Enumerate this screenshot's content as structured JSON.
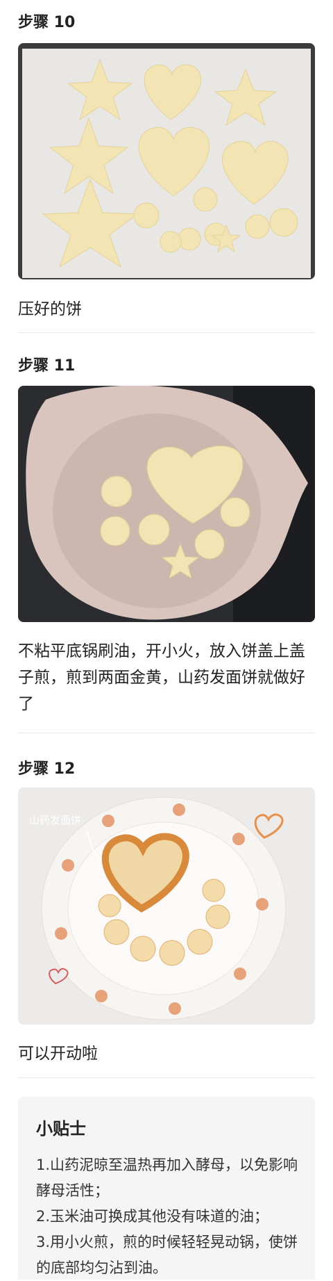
{
  "steps": [
    {
      "title": "步骤 10",
      "photo_icon": "baking-tray-photo",
      "description": "压好的饼"
    },
    {
      "title": "步骤 11",
      "photo_icon": "frying-pan-photo",
      "description": "不粘平底锅刷油，开小火，放入饼盖上盖子煎，煎到两面金黄，山药发面饼就做好了"
    },
    {
      "title": "步骤 12",
      "photo_icon": "plated-pancakes-photo",
      "photo_caption": "山药发面饼",
      "description": "可以开动啦"
    }
  ],
  "tips": {
    "title": "小贴士",
    "items": [
      "1.山药泥晾至温热再加入酵母，以免影响酵母活性；",
      "2.玉米油可换成其他没有味道的油；",
      "3.用小火煎，煎的时候轻轻晃动锅，使饼的底部均匀沾到油。"
    ]
  },
  "colors": {
    "dough": "#f2e4b3",
    "paper": "#e9e7e3",
    "pan": "#dcc8c2",
    "fried": "#e0953a"
  }
}
